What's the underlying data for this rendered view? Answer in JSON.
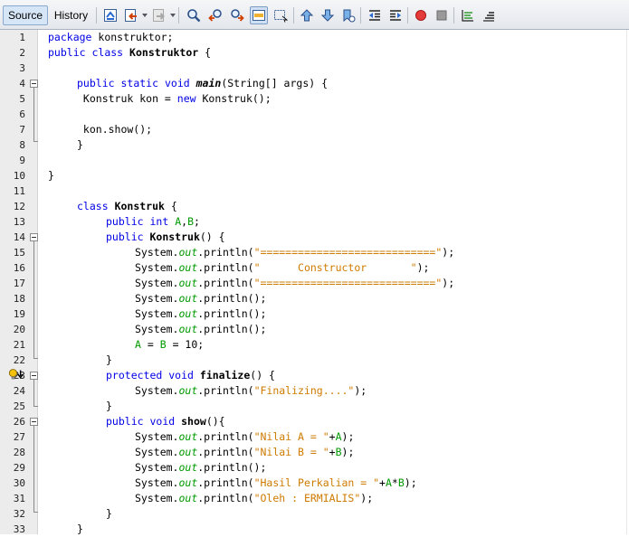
{
  "toolbar": {
    "tabs": [
      {
        "label": "Source",
        "active": true
      },
      {
        "label": "History",
        "active": false
      }
    ],
    "buttons": [
      "last-edit-icon",
      "back-icon",
      "forward-icon",
      "find-selection-icon",
      "find-previous-icon",
      "find-next-icon",
      "toggle-highlight-icon",
      "toggle-rect-select-icon",
      "previous-bookmark-icon",
      "next-bookmark-icon",
      "toggle-bookmark-icon",
      "shift-left-icon",
      "shift-right-icon",
      "start-macro-icon",
      "stop-macro-icon",
      "comment-icon",
      "uncomment-icon"
    ]
  },
  "gutter": {
    "line_numbers": [
      "1",
      "2",
      "3",
      "4",
      "5",
      "6",
      "7",
      "8",
      "9",
      "10",
      "11",
      "12",
      "13",
      "14",
      "15",
      "16",
      "17",
      "18",
      "19",
      "20",
      "21",
      "22",
      "23",
      "24",
      "25",
      "26",
      "27",
      "28",
      "29",
      "30",
      "31",
      "32",
      "33"
    ],
    "fold_markers": [
      4,
      14,
      23,
      26
    ],
    "hint_line": 23
  },
  "code": {
    "l1": {
      "kw": "package",
      "rest": " konstruktor;"
    },
    "l2": {
      "kw1": "public",
      "kw2": "class",
      "name": "Konstruktor",
      "rest": " {"
    },
    "l4": {
      "kw1": "public",
      "kw2": "static",
      "kw3": "void",
      "name": "main",
      "rest": "(String[] args) {"
    },
    "l5": {
      "a": " Konstruk kon = ",
      "kw": "new",
      "b": " Konstruk();"
    },
    "l7": {
      "text": " kon.show();"
    },
    "l8": {
      "text": "}"
    },
    "l10": {
      "text": "}"
    },
    "l12": {
      "kw": "class",
      "name": "Konstruk",
      "rest": " {"
    },
    "l13": {
      "kw1": "public",
      "kw2": "int",
      "f1": "A",
      "comma": ",",
      "f2": "B",
      "semi": ";"
    },
    "l14": {
      "kw": "public",
      "name": "Konstruk",
      "rest": "() {"
    },
    "l15": {
      "a": "System.",
      "out": "out",
      "b": ".println(",
      "str": "\"============================\"",
      "c": ");"
    },
    "l16": {
      "a": "System.",
      "out": "out",
      "b": ".println(",
      "str": "\"      Constructor       \"",
      "c": ");"
    },
    "l17": {
      "a": "System.",
      "out": "out",
      "b": ".println(",
      "str": "\"============================\"",
      "c": ");"
    },
    "l18": {
      "a": "System.",
      "out": "out",
      "b": ".println();"
    },
    "l19": {
      "a": "System.",
      "out": "out",
      "b": ".println();"
    },
    "l20": {
      "a": "System.",
      "out": "out",
      "b": ".println();"
    },
    "l21": {
      "f1": "A",
      "eq1": " = ",
      "f2": "B",
      "rest": " = 10;"
    },
    "l22": {
      "text": "}"
    },
    "l23": {
      "kw1": "protected",
      "kw2": "void",
      "name": "finalize",
      "rest": "() {"
    },
    "l24": {
      "a": "System.",
      "out": "out",
      "b": ".println(",
      "str": "\"Finalizing....\"",
      "c": ");"
    },
    "l25": {
      "text": "}"
    },
    "l26": {
      "kw1": "public",
      "kw2": "void",
      "name": "show",
      "rest": "(){"
    },
    "l27": {
      "a": "System.",
      "out": "out",
      "b": ".println(",
      "str": "\"Nilai A = \"",
      "plus": "+",
      "f": "A",
      "c": ");"
    },
    "l28": {
      "a": "System.",
      "out": "out",
      "b": ".println(",
      "str": "\"Nilai B = \"",
      "plus": "+",
      "f": "B",
      "c": ");"
    },
    "l29": {
      "a": "System.",
      "out": "out",
      "b": ".println();"
    },
    "l30": {
      "a": "System.",
      "out": "out",
      "b": ".println(",
      "str": "\"Hasil Perkalian = \"",
      "plus": "+",
      "f1": "A",
      "star": "*",
      "f2": "B",
      "c": ");"
    },
    "l31": {
      "a": "System.",
      "out": "out",
      "b": ".println(",
      "str": "\"Oleh : ERMIALIS\"",
      "c": ");"
    },
    "l32": {
      "text": "}"
    },
    "l33": {
      "text": "}"
    }
  },
  "colors": {
    "keyword": "#0000e6",
    "string": "#ce7b00",
    "field": "#009900",
    "gutter_bg": "#ececec"
  }
}
